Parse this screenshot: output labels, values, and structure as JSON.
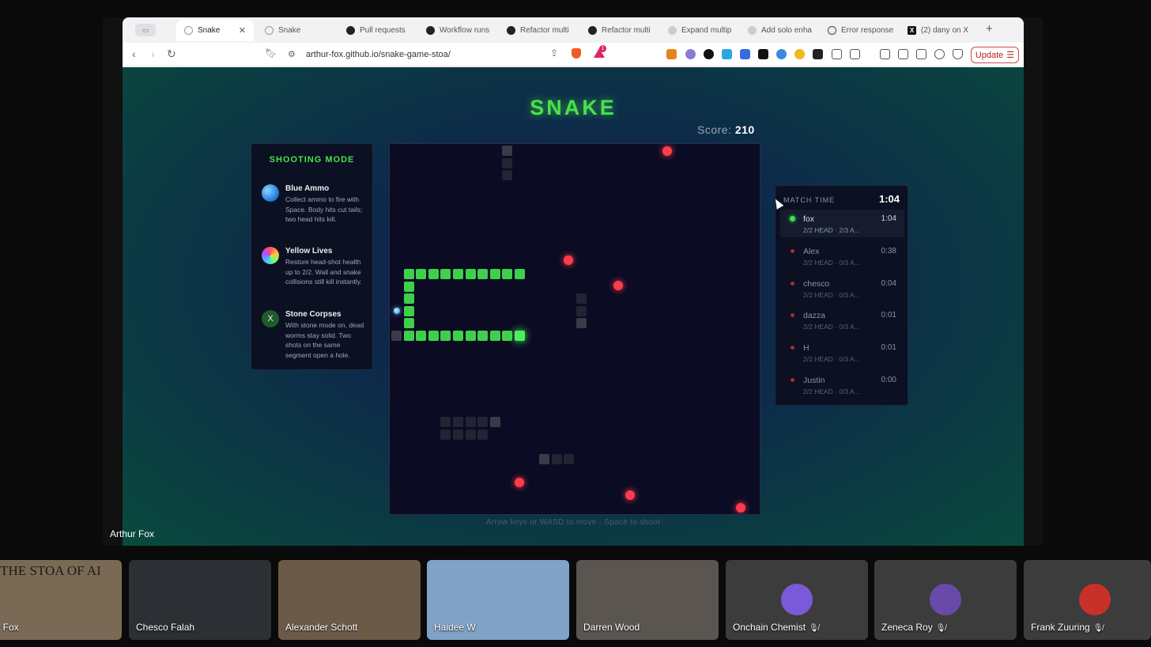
{
  "browser": {
    "tabs": [
      {
        "label": "Snake",
        "icon": "globe",
        "active": true
      },
      {
        "label": "Snake",
        "icon": "globe"
      },
      {
        "label": "Pull requests",
        "icon": "github"
      },
      {
        "label": "Workflow runs",
        "icon": "github"
      },
      {
        "label": "Refactor multi",
        "icon": "github"
      },
      {
        "label": "Refactor multi",
        "icon": "github"
      },
      {
        "label": "Expand multip",
        "icon": "github-loading"
      },
      {
        "label": "Add solo enha",
        "icon": "github-loading"
      },
      {
        "label": "Error response",
        "icon": "power"
      },
      {
        "label": "(2) dany on X",
        "icon": "x-logo"
      }
    ],
    "url": "arthur-fox.github.io/snake-game-stoa/",
    "update_label": "Update",
    "rewards_badge": "1"
  },
  "game": {
    "title": "SNAKE",
    "score_label": "Score:",
    "score_value": "210",
    "hint": "Arrow keys or WASD to move · Space to shoot",
    "info_panel": {
      "title": "SHOOTING MODE",
      "items": [
        {
          "name": "Blue Ammo",
          "icon": "blue-orb-icon",
          "desc": "Collect ammo to fire with Space. Body hits cut tails; two head hits kill."
        },
        {
          "name": "Yellow Lives",
          "icon": "rainbow-orb-icon",
          "desc": "Restore head-shot health up to 2/2. Wall and snake collisions still kill instantly."
        },
        {
          "name": "Stone Corpses",
          "icon": "stone-x-icon",
          "icon_text": "X",
          "desc": "With stone mode on, dead worms stay solid. Two shots on the same segment open a hole."
        }
      ]
    },
    "match": {
      "label": "MATCH TIME",
      "time": "1:04",
      "players": [
        {
          "name": "fox",
          "stats": "2/2 HEAD · 2/3 A...",
          "time": "1:04",
          "alive": true
        },
        {
          "name": "Alex",
          "stats": "2/2 HEAD · 0/3 A...",
          "time": "0:38",
          "alive": false
        },
        {
          "name": "chesco",
          "stats": "2/2 HEAD · 0/3 A...",
          "time": "0:04",
          "alive": false
        },
        {
          "name": "dazza",
          "stats": "2/2 HEAD · 0/3 A...",
          "time": "0:01",
          "alive": false
        },
        {
          "name": "H",
          "stats": "2/2 HEAD · 0/3 A...",
          "time": "0:01",
          "alive": false
        },
        {
          "name": "Justin",
          "stats": "2/2 HEAD · 0/3 A...",
          "time": "0:00",
          "alive": false
        }
      ]
    },
    "colors": {
      "snake": "#3fd04a",
      "apple": "#ff3c4a",
      "title": "#4ae04a"
    }
  },
  "call": {
    "presenter": "Arthur Fox",
    "participants": [
      {
        "name": "hur Fox",
        "bg": "#7a6a55",
        "banner": "THE STOA OF AI",
        "muted": false
      },
      {
        "name": "Chesco Falah",
        "bg": "#2c2f33",
        "muted": false
      },
      {
        "name": "Alexander Schott",
        "bg": "#6b5a47",
        "muted": false
      },
      {
        "name": "Haidee W",
        "bg": "#7fa2c6",
        "muted": false
      },
      {
        "name": "Darren Wood",
        "bg": "#5a5550",
        "muted": false
      },
      {
        "name": "Onchain Chemist",
        "bg": "#3c3c3c",
        "muted": true,
        "avatar": "#7a5ad8"
      },
      {
        "name": "Zeneca Roy",
        "bg": "#3c3c3c",
        "muted": true,
        "avatar": "#6a4aa8"
      },
      {
        "name": "Frank Zuuring",
        "bg": "#3c3c3c",
        "muted": true,
        "avatar": "#c8302a"
      }
    ]
  }
}
